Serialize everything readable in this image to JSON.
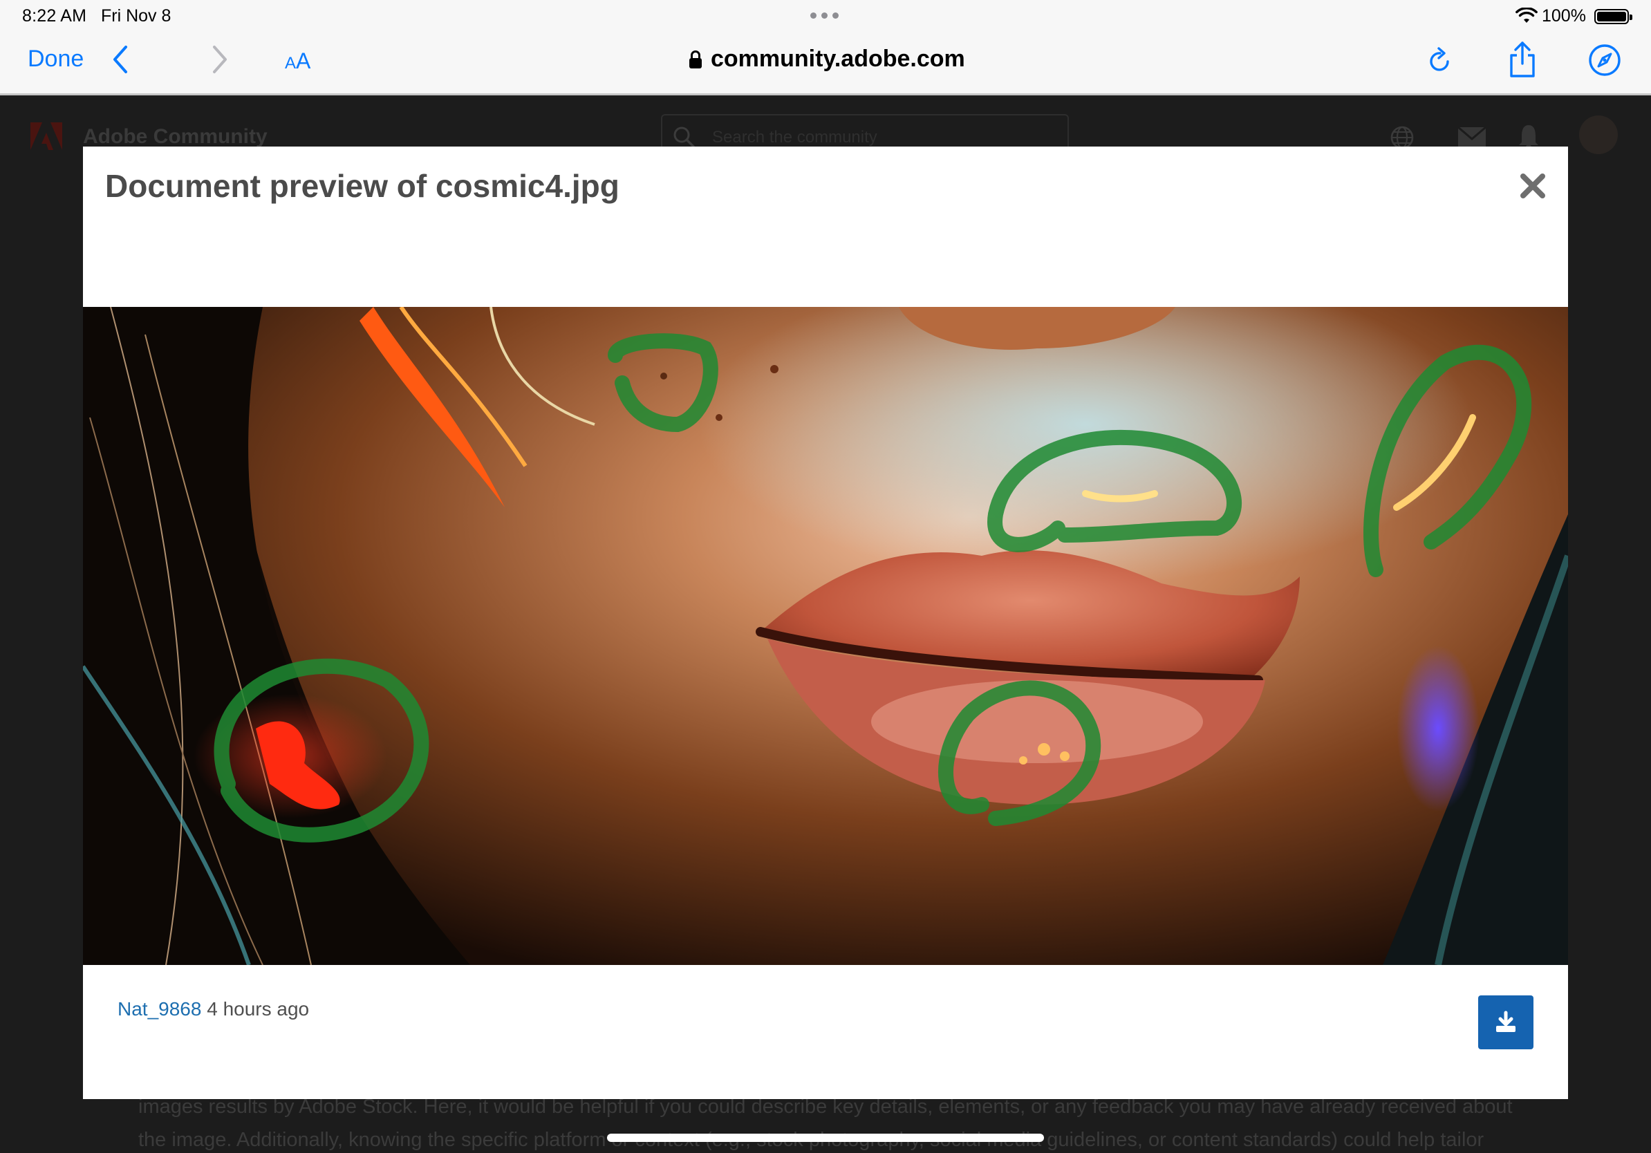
{
  "status_bar": {
    "time": "8:22 AM",
    "date": "Fri Nov 8",
    "battery": "100%"
  },
  "browser": {
    "done_label": "Done",
    "text_size_small": "A",
    "text_size_large": "A",
    "url_host": "community.adobe.com"
  },
  "page": {
    "site_title": "Adobe Community",
    "search_placeholder": "Search the community",
    "body_lines": [
      "images results by Adobe Stock. Here, it would be helpful if you could describe key details, elements, or any feedback you may have already received about",
      "the image. Additionally, knowing the specific platform or context (e.g., stock photography, social media guidelines, or content standards) could help tailor"
    ]
  },
  "modal": {
    "title": "Document preview of cosmic4.jpg",
    "author": "Nat_9868",
    "timestamp": "4 hours ago",
    "icons": {
      "close": "close-icon",
      "download": "download-icon"
    }
  },
  "colors": {
    "link_blue": "#0a7aff",
    "author_blue": "#1e6fb0",
    "download_button": "#1563b0",
    "annotation_green": "#1f8a32"
  }
}
